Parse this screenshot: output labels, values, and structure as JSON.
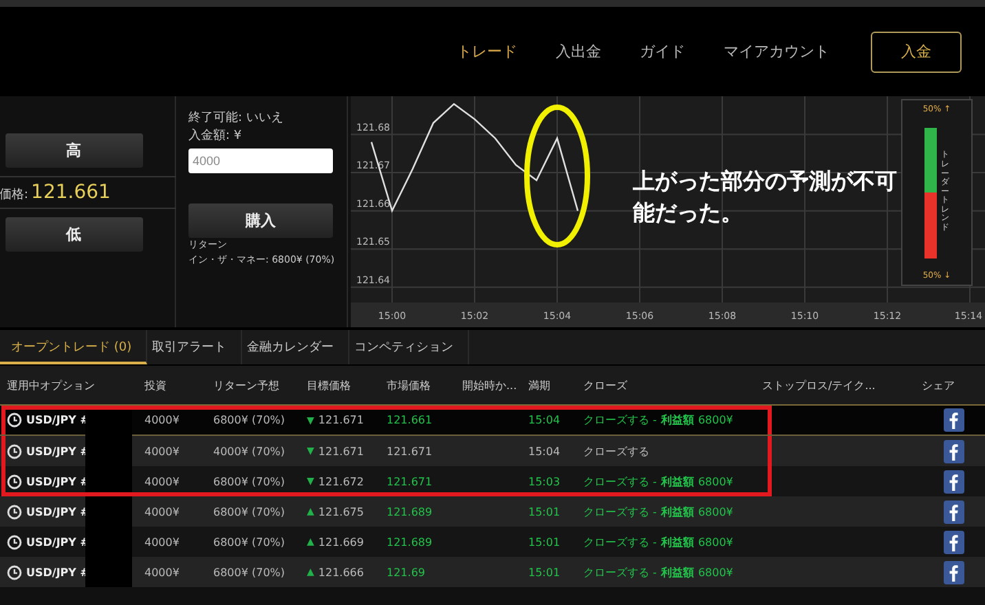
{
  "nav": {
    "items": [
      {
        "label": "トレード",
        "selected": true
      },
      {
        "label": "入出金",
        "selected": false
      },
      {
        "label": "ガイド",
        "selected": false
      },
      {
        "label": "マイアカウント",
        "selected": false
      }
    ],
    "deposit_button": "入金"
  },
  "trade_panel": {
    "high_button": "高",
    "price_label": "価格:",
    "price_value": "121.661",
    "low_button": "低",
    "expiry_note": "終了可能: いいえ",
    "amount_label": "入金額: ¥",
    "amount_value": "4000",
    "buy_button": "購入",
    "return_label": "リターン",
    "return_value": "イン・ザ・マネー: 6800¥ (70%)"
  },
  "chart": {
    "chart_data": {
      "type": "line",
      "categories": [
        null,
        "15:00",
        null,
        null,
        null,
        "15:02",
        null,
        null,
        null,
        "15:04",
        null,
        null,
        null,
        "15:06",
        null,
        null,
        null,
        "15:08",
        null,
        null,
        null,
        "15:10",
        null,
        null,
        null,
        "15:12",
        null,
        null,
        null,
        "15:14"
      ],
      "series": [
        {
          "color": "#e0e0e0",
          "values": [
            121.678,
            121.66,
            121.671,
            121.683,
            121.688,
            121.684,
            121.679,
            121.672,
            121.668,
            121.679,
            121.66,
            null,
            null,
            null,
            null,
            null,
            null,
            null,
            null,
            null,
            null,
            null,
            null,
            null,
            null,
            null,
            null,
            null,
            null,
            null
          ]
        }
      ],
      "ylim": [
        121.636,
        121.69
      ],
      "grid": true,
      "yticks": [
        {
          "value": 121.64,
          "label": "121.64"
        },
        {
          "value": 121.65,
          "label": "121.65"
        },
        {
          "value": 121.66,
          "label": "121.66"
        },
        {
          "value": 121.67,
          "label": "121.67"
        },
        {
          "value": 121.68,
          "label": "121.68"
        }
      ]
    },
    "trend": {
      "up_label": "50% ↑",
      "down_label": "50% ↓",
      "title": "トレーダートレンド",
      "level": 0.5
    },
    "annotation": "上がった部分の予測が不可能だった。"
  },
  "tabs": [
    {
      "label": "オープントレード (0)",
      "selected": true
    },
    {
      "label": "取引アラート",
      "selected": false
    },
    {
      "label": "金融カレンダー",
      "selected": false
    },
    {
      "label": "コンペティション",
      "selected": false
    }
  ],
  "table": {
    "columns": [
      "運用中オプション",
      "投資",
      "リターン予想",
      "目標価格",
      "市場価格",
      "開始時か...",
      "満期",
      "クローズ",
      "ストップロス/テイク...",
      "シェア"
    ],
    "rows": [
      {
        "option": "USD/JPY #",
        "investment": "4000¥",
        "expected_return": "6800¥ (70%)",
        "target_arrow": "▼",
        "target": "121.671",
        "market": "121.661",
        "expiry": "15:04",
        "close": "クローズする - **利益額** 6800¥",
        "in_money": true,
        "highlighted": true,
        "selected": true
      },
      {
        "option": "USD/JPY #",
        "investment": "4000¥",
        "expected_return": "4000¥ (70%)",
        "target_arrow": "▼",
        "target": "121.671",
        "market": "121.671",
        "expiry": "15:04",
        "close": "クローズする",
        "in_money": false,
        "highlighted": true,
        "selected": false
      },
      {
        "option": "USD/JPY #",
        "investment": "4000¥",
        "expected_return": "6800¥ (70%)",
        "target_arrow": "▼",
        "target": "121.672",
        "market": "121.671",
        "expiry": "15:03",
        "close": "クローズする - **利益額** 6800¥",
        "in_money": true,
        "highlighted": true,
        "selected": false
      },
      {
        "option": "USD/JPY #",
        "investment": "4000¥",
        "expected_return": "6800¥ (70%)",
        "target_arrow": "▲",
        "target": "121.675",
        "market": "121.689",
        "expiry": "15:01",
        "close": "クローズする - **利益額** 6800¥",
        "in_money": true,
        "highlighted": false,
        "selected": false
      },
      {
        "option": "USD/JPY #",
        "investment": "4000¥",
        "expected_return": "6800¥ (70%)",
        "target_arrow": "▲",
        "target": "121.669",
        "market": "121.689",
        "expiry": "15:01",
        "close": "クローズする - **利益額** 6800¥",
        "in_money": true,
        "highlighted": false,
        "selected": false
      },
      {
        "option": "USD/JPY #",
        "investment": "4000¥",
        "expected_return": "6800¥ (70%)",
        "target_arrow": "▲",
        "target": "121.666",
        "market": "121.69",
        "expiry": "15:01",
        "close": "クローズする - **利益額** 6800¥",
        "in_money": true,
        "highlighted": false,
        "selected": false
      }
    ]
  }
}
